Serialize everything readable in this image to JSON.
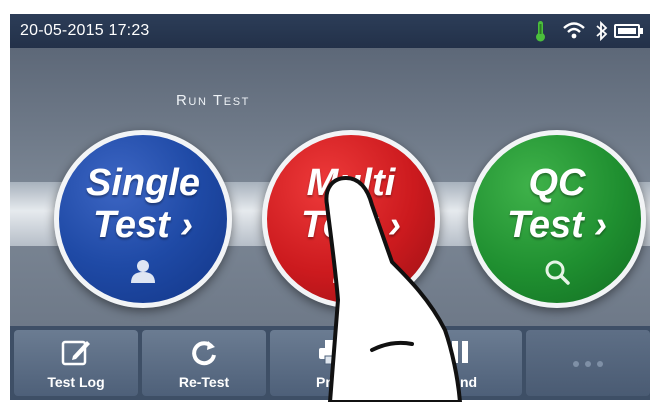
{
  "status_bar": {
    "datetime": "20-05-2015  17:23",
    "icons": [
      "thermometer-icon",
      "wifi-icon",
      "bluetooth-icon",
      "battery-icon"
    ]
  },
  "main": {
    "section_title": "Run Test",
    "buttons": [
      {
        "line1": "Single",
        "line2": "Test",
        "icon": "person-icon",
        "color": "#1f4aa6"
      },
      {
        "line1": "Multi",
        "line2": "Test",
        "icon": "people-icon",
        "color": "#cc1a1e"
      },
      {
        "line1": "QC",
        "line2": "Test",
        "icon": "magnifier-icon",
        "color": "#1f8f30"
      }
    ]
  },
  "toolbar": {
    "buttons": [
      {
        "label": "Test Log",
        "icon": "edit-icon"
      },
      {
        "label": "Re-Test",
        "icon": "refresh-icon"
      },
      {
        "label": "Print",
        "icon": "printer-icon"
      },
      {
        "label": "Send",
        "icon": "send-icon"
      },
      {
        "label": "",
        "icon": "more-icon"
      }
    ]
  },
  "colors": {
    "status_bar": "#233149",
    "toolbar": "#3e4f66",
    "thermometer": "#4bbf3c"
  }
}
